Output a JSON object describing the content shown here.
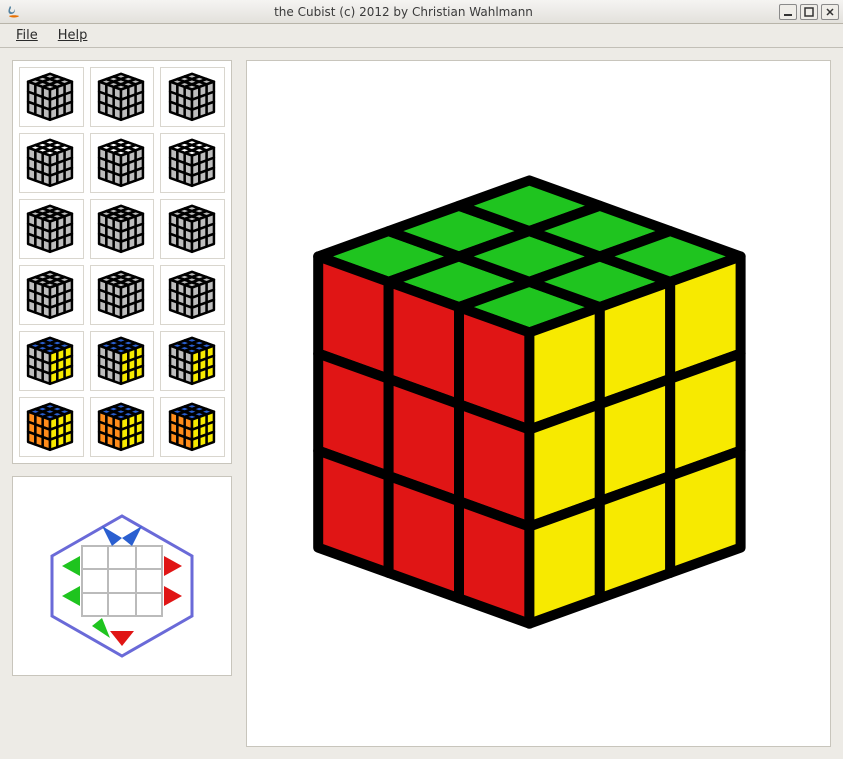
{
  "window": {
    "title": "the Cubist (c) 2012 by Christian Wahlmann",
    "minimize": "_",
    "maximize": "□",
    "close": "×"
  },
  "menu": {
    "file": "File",
    "help": "Help"
  },
  "palette": {
    "top": "#1fc41f",
    "front": "#f7ea00",
    "left": "#e01515",
    "edge": "#000000",
    "grey": "#bdbdbd",
    "blue": "#2a5fd0",
    "orange": "#ff8c1a",
    "white": "#ffffff"
  },
  "thumbnails": [
    {
      "name": "step-1a",
      "top": "grey",
      "front": "grey",
      "left": "grey",
      "accent": "white"
    },
    {
      "name": "step-1b",
      "top": "grey",
      "front": "grey",
      "left": "grey",
      "accent": "white"
    },
    {
      "name": "step-1c",
      "top": "grey",
      "front": "grey",
      "left": "grey",
      "accent": "white"
    },
    {
      "name": "step-2a",
      "top": "white",
      "front": "grey",
      "left": "grey",
      "accent": "mixed"
    },
    {
      "name": "step-2b",
      "top": "white",
      "front": "grey",
      "left": "grey",
      "accent": "mixed"
    },
    {
      "name": "step-2c",
      "top": "white",
      "front": "grey",
      "left": "grey",
      "accent": "mixed"
    },
    {
      "name": "step-3a",
      "top": "grey",
      "front": "grey",
      "left": "grey",
      "accent": "blue"
    },
    {
      "name": "step-3b",
      "top": "grey",
      "front": "grey",
      "left": "grey",
      "accent": "blue"
    },
    {
      "name": "step-3c",
      "top": "grey",
      "front": "grey",
      "left": "grey",
      "accent": "blue"
    },
    {
      "name": "step-4a",
      "top": "grey",
      "front": "grey",
      "left": "grey",
      "accent": "none"
    },
    {
      "name": "step-4b",
      "top": "grey",
      "front": "grey",
      "left": "grey",
      "accent": "none"
    },
    {
      "name": "step-4c",
      "top": "grey",
      "front": "grey",
      "left": "grey",
      "accent": "none"
    },
    {
      "name": "step-5a",
      "top": "blue",
      "front": "yellow",
      "left": "grey",
      "accent": "none"
    },
    {
      "name": "step-5b",
      "top": "blue",
      "front": "yellow",
      "left": "grey",
      "accent": "none"
    },
    {
      "name": "step-5c",
      "top": "blue",
      "front": "yellow",
      "left": "grey",
      "accent": "none"
    },
    {
      "name": "step-6a",
      "top": "blue",
      "front": "yellow",
      "left": "orange",
      "accent": "none"
    },
    {
      "name": "step-6b",
      "top": "blue",
      "front": "yellow",
      "left": "orange",
      "accent": "none"
    },
    {
      "name": "step-6c",
      "top": "blue",
      "front": "yellow",
      "left": "orange",
      "accent": "none"
    }
  ],
  "main_cube": {
    "top_face": "top",
    "front_face": "front",
    "left_face": "left"
  },
  "preview": {
    "name": "unfolded-layout"
  }
}
